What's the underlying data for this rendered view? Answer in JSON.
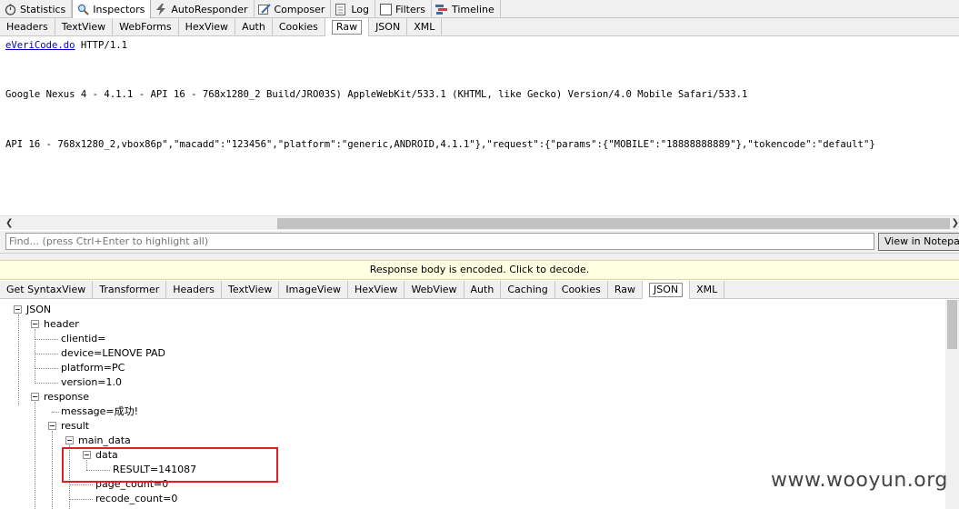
{
  "main_tabs": [
    {
      "label": "Statistics",
      "icon": "stopwatch-icon"
    },
    {
      "label": "Inspectors",
      "icon": "magnifier-icon"
    },
    {
      "label": "AutoResponder",
      "icon": "lightning-icon"
    },
    {
      "label": "Composer",
      "icon": "pencil-icon"
    },
    {
      "label": "Log",
      "icon": "log-icon"
    },
    {
      "label": "Filters",
      "icon": "checkbox-icon"
    },
    {
      "label": "Timeline",
      "icon": "timeline-icon"
    }
  ],
  "request_tabs": [
    "Headers",
    "TextView",
    "WebForms",
    "HexView",
    "Auth",
    "Cookies",
    "Raw",
    "JSON",
    "XML"
  ],
  "request_active_tab": "Raw",
  "raw": {
    "line1_link": "eVeriCode.do",
    "line1_rest": " HTTP/1.1",
    "line2": "Google Nexus 4 - 4.1.1 - API 16 - 768x1280_2 Build/JRO03S) AppleWebKit/533.1 (KHTML, like Gecko) Version/4.0 Mobile Safari/533.1",
    "line3": "API 16 - 768x1280_2,vbox86p\",\"macadd\":\"123456\",\"platform\":\"generic,ANDROID,4.1.1\"},\"request\":{\"params\":{\"MOBILE\":\"18888888889\"},\"tokencode\":\"default\"}"
  },
  "find": {
    "placeholder": "Find... (press Ctrl+Enter to highlight all)",
    "notepad_button": "View in Notepad"
  },
  "notice": "Response body is encoded. Click to decode.",
  "response_tabs": [
    "Get SyntaxView",
    "Transformer",
    "Headers",
    "TextView",
    "ImageView",
    "HexView",
    "WebView",
    "Auth",
    "Caching",
    "Cookies",
    "Raw",
    "JSON",
    "XML"
  ],
  "response_active_tab": "JSON",
  "tree": {
    "root": "JSON",
    "header": "header",
    "clientid": "clientid=",
    "device": "device=LENOVE PAD",
    "platform": "platform=PC",
    "version": "version=1.0",
    "response": "response",
    "message": "message=成功!",
    "result": "result",
    "main_data": "main_data",
    "data": "data",
    "result_value": "RESULT=141087",
    "page_count": "page_count=0",
    "recode_count": "recode_count=0"
  },
  "watermark": "www.wooyun.org"
}
